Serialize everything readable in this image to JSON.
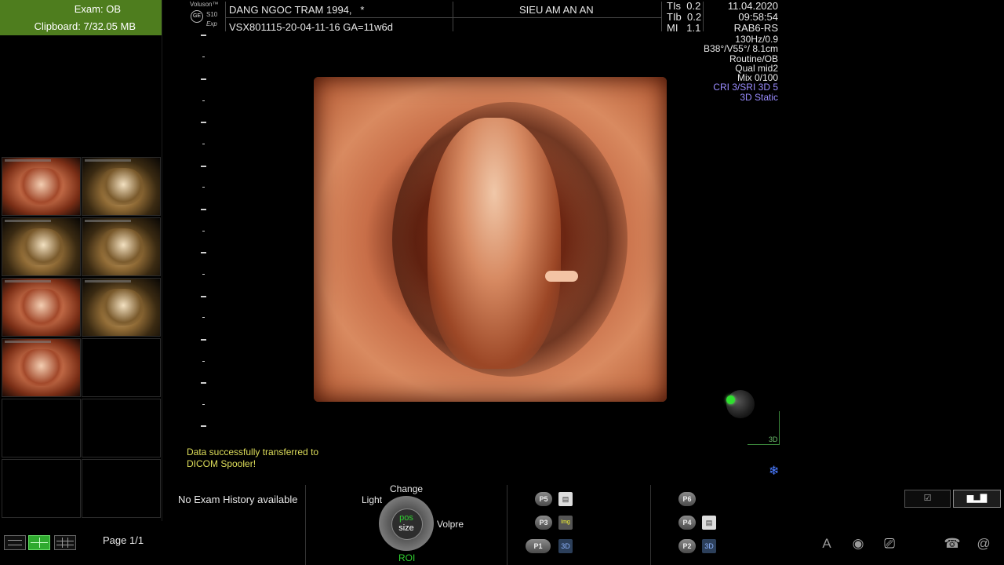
{
  "exam": {
    "label": "Exam:",
    "value": "OB"
  },
  "clipboard": {
    "label": "Clipboard:",
    "value": "7/32.05 MB"
  },
  "page_label": "Page 1/1",
  "logo": {
    "brand": "Voluson™",
    "model": "S10",
    "sub": "Exp",
    "ge": "GE"
  },
  "patient": {
    "name": "DANG NGOC TRAM 1994,",
    "marker": "*",
    "id_line": "VSX801115-20-04-11-16  GA=11w6d"
  },
  "clinic": "SIEU AM AN AN",
  "indices": {
    "tis_label": "TIs",
    "tis": "0.2",
    "tib_label": "TIb",
    "tib": "0.2",
    "mi_label": "MI",
    "mi": "1.1"
  },
  "datetime": {
    "date": "11.04.2020",
    "time": "09:58:54",
    "probe": "RAB6-RS"
  },
  "params": [
    "130Hz/0.9",
    "B38°/V55°/ 8.1cm",
    "Routine/OB",
    "Qual mid2",
    "Mix 0/100"
  ],
  "params_blue": [
    "CRI 3/SRI 3D 5",
    "3D Static"
  ],
  "status": {
    "transfer_line1": "Data successfully transferred to",
    "transfer_line2": "DICOM Spooler!"
  },
  "orientation_label": "3D",
  "no_history": "No Exam History available",
  "knob": {
    "top": "Change",
    "left": "Light",
    "right": "Volpre",
    "bottom": "ROI",
    "center_top": "pos",
    "center_bottom": "size"
  },
  "pbuttons": {
    "p1": "P1",
    "p2": "P2",
    "p3": "P3",
    "p4": "P4",
    "p5": "P5",
    "p6": "P6"
  },
  "picons": {
    "img": "Img",
    "disk": "3D"
  },
  "icons": {
    "snow": "snowflake-icon",
    "layout": [
      "single-layout-icon",
      "dual-layout-icon",
      "grid-layout-icon"
    ],
    "bottom_right": [
      "font-icon",
      "globe-icon",
      "network-icon",
      "phone-icon",
      "at-icon"
    ],
    "top_right_buttons": [
      "checkbox-icon",
      "histogram-icon"
    ]
  },
  "bottom_right_glyphs": {
    "font": "A",
    "at": "@"
  },
  "colors": {
    "exam_header": "#4e7d1e",
    "status_text": "#dede5a",
    "param_blue": "#9a8cff",
    "active_green": "#2faa2f"
  }
}
